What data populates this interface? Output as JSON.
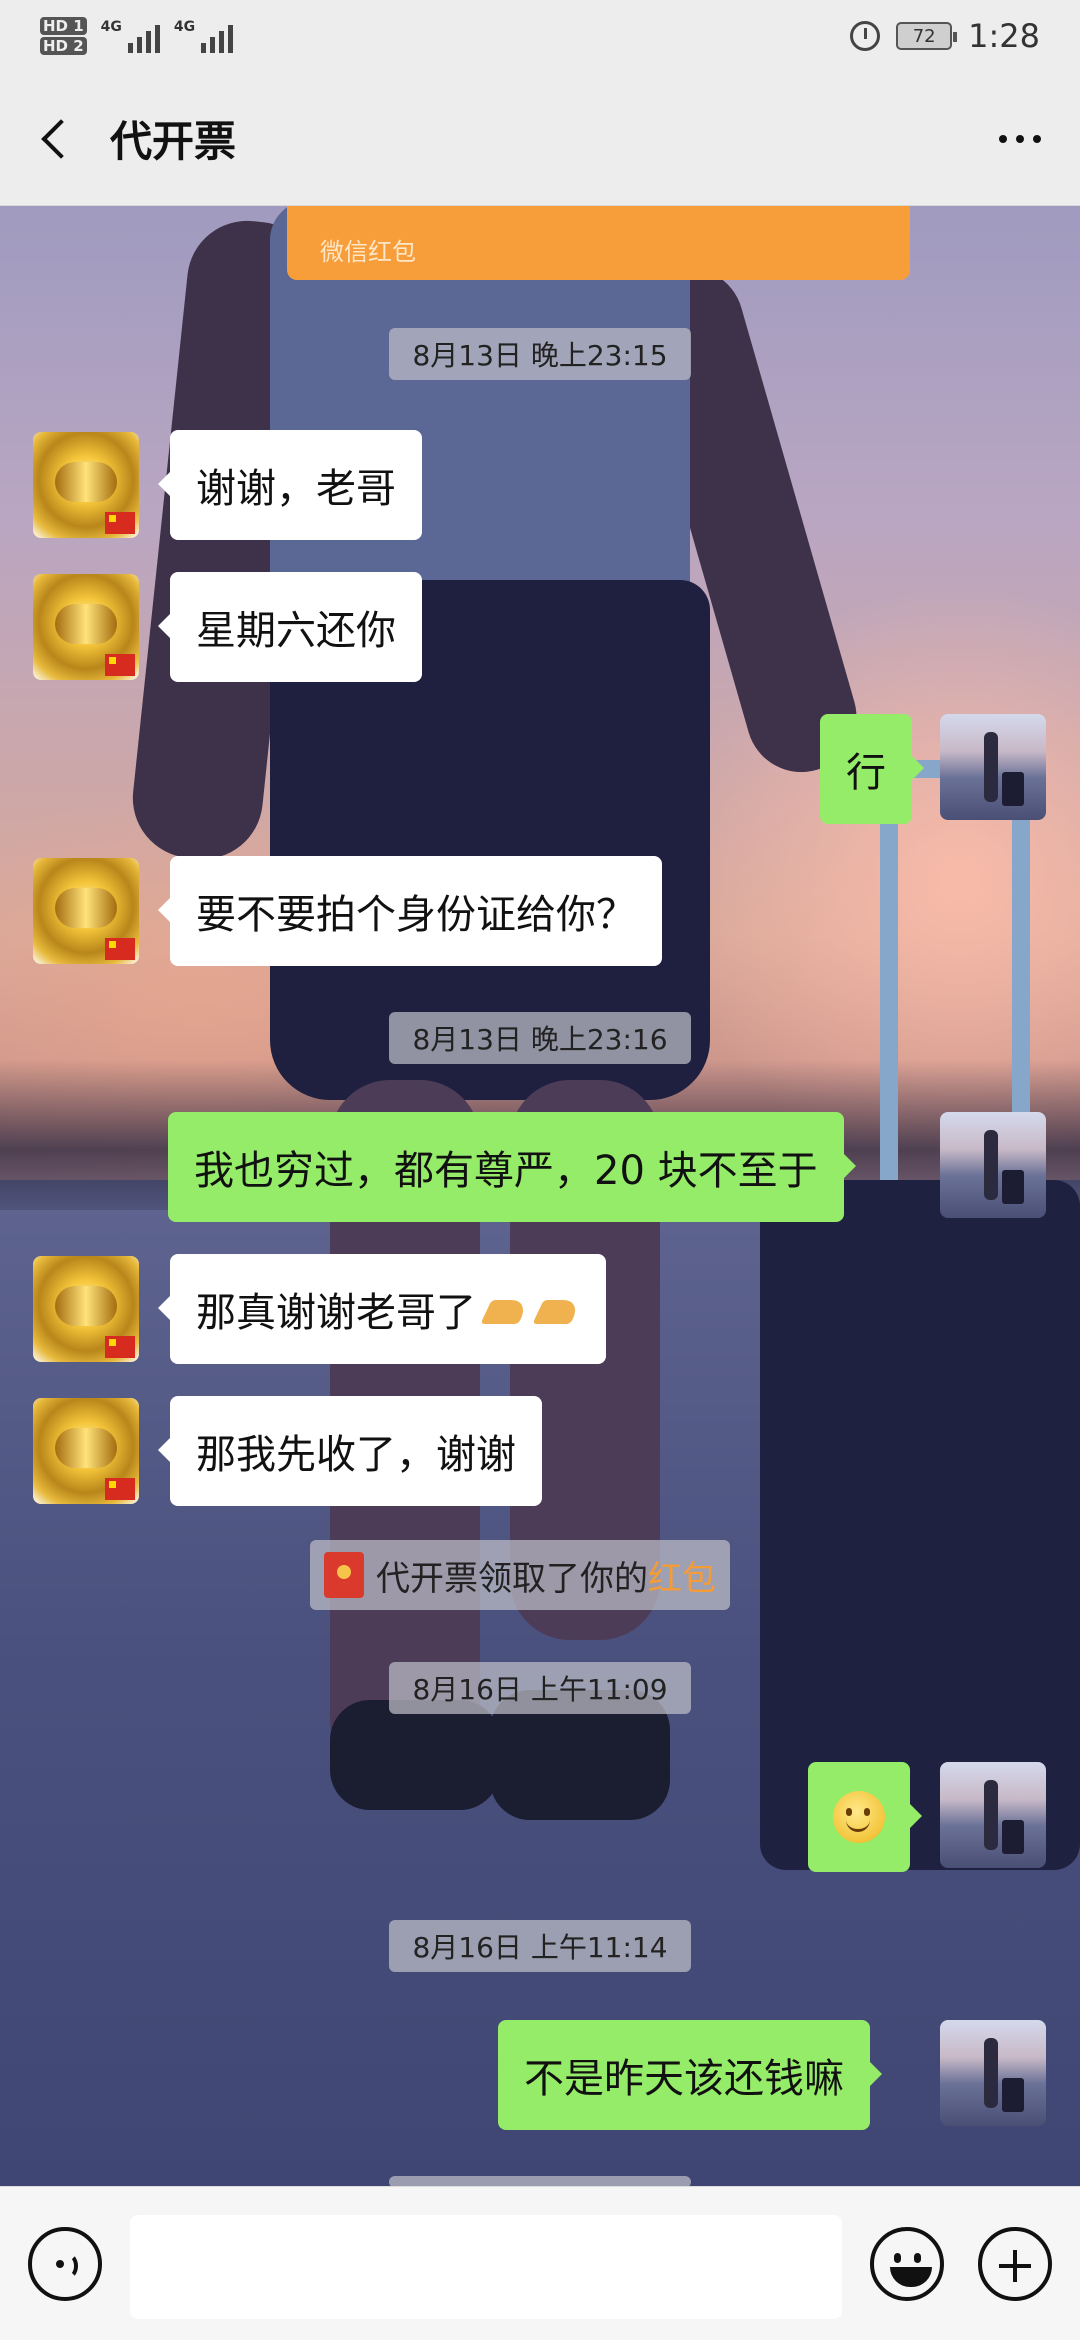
{
  "status_bar": {
    "sim1": "HD 1",
    "sim2": "HD 2",
    "net1": "4G",
    "net2": "4G",
    "battery": "72",
    "time": "1:28"
  },
  "header": {
    "title": "代开票"
  },
  "chat": {
    "top_card_label": "微信红包",
    "timestamps": [
      "8月13日 晚上23:15",
      "8月13日 晚上23:16",
      "8月16日 上午11:09",
      "8月16日 上午11:14"
    ],
    "messages": [
      {
        "from": "other",
        "text": "谢谢，老哥"
      },
      {
        "from": "other",
        "text": "星期六还你"
      },
      {
        "from": "me",
        "text": "行"
      },
      {
        "from": "other",
        "text": "要不要拍个身份证给你？"
      },
      {
        "from": "me",
        "text": "我也穷过，都有尊严，20 块不至于"
      },
      {
        "from": "other",
        "text": "那真谢谢老哥了"
      },
      {
        "from": "other",
        "text": "那我先收了，谢谢"
      },
      {
        "from": "me",
        "text": "",
        "emoji": "smiley-icon"
      },
      {
        "from": "me",
        "text": "不是昨天该还钱嘛"
      }
    ],
    "system_message": {
      "text": "代开票领取了你的",
      "link": "红包"
    }
  },
  "input_bar": {
    "placeholder": ""
  },
  "colors": {
    "bubble_out": "#95ec69",
    "bubble_in": "#ffffff",
    "red_packet": "#f79e3a",
    "link_orange": "#f49c37"
  }
}
